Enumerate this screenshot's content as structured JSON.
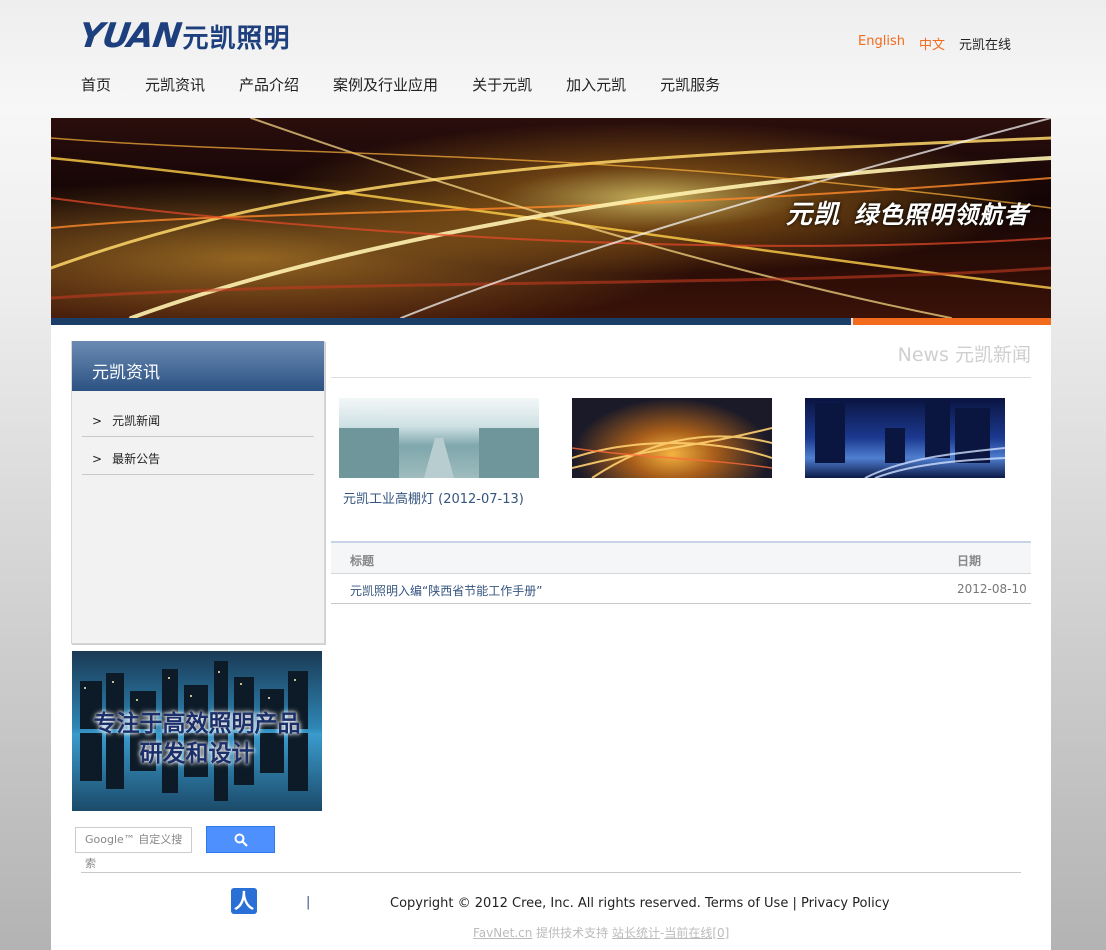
{
  "header": {
    "logo_latin": "YUAN",
    "logo_cn": "元凯照明",
    "lang": {
      "english": "English",
      "chinese": "中文",
      "online": "元凯在线"
    },
    "nav": [
      "首页",
      "元凯资讯",
      "产品介绍",
      "案例及行业应用",
      "关于元凯",
      "加入元凯",
      "元凯服务"
    ]
  },
  "banner": {
    "brand": "元凯",
    "slogan": "绿色照明领航者"
  },
  "sidebar": {
    "title": "元凯资讯",
    "items": [
      {
        "label": "元凯新闻"
      },
      {
        "label": "最新公告"
      }
    ],
    "promo_line1": "专注于高效照明产品",
    "promo_line2": "研发和设计",
    "search_placeholder": "Google™ 自定义搜索"
  },
  "main": {
    "title": "News 元凯新闻",
    "thumbs": [
      {
        "caption": "元凯工业高棚灯 (2012-07-13)"
      },
      {
        "caption": ""
      },
      {
        "caption": ""
      }
    ],
    "table": {
      "col_title": "标题",
      "col_date": "日期",
      "rows": [
        {
          "title": "元凯照明入编“陕西省节能工作手册”",
          "date": "2012-08-10"
        }
      ]
    }
  },
  "footer": {
    "sep": "|",
    "copyright": "Copyright © 2012 Cree, Inc. All rights reserved. Terms of Use | Privacy Policy",
    "credit_site": "FavNet.cn",
    "credit_text": " 提供技术支持 ",
    "credit_stats": "站长统计",
    "credit_dash": "-",
    "credit_online": "当前在线[0]"
  },
  "colors": {
    "accent": "#f26a1b",
    "brand_blue": "#1e3f7e",
    "nav_bar": "#1b3e69"
  }
}
